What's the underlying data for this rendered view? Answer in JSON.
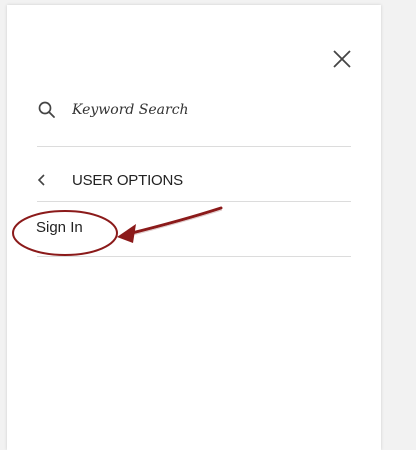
{
  "menu": {
    "search": {
      "placeholder": "Keyword Search"
    },
    "section": {
      "back_label": "USER OPTIONS"
    },
    "items": [
      {
        "label": "Sign In"
      }
    ]
  },
  "icons": {
    "close": "close-icon",
    "search": "search-icon",
    "back": "chevron-left-icon"
  },
  "colors": {
    "annotation": "#8b1a1a",
    "divider": "#dcdcdc",
    "text": "#222222"
  }
}
